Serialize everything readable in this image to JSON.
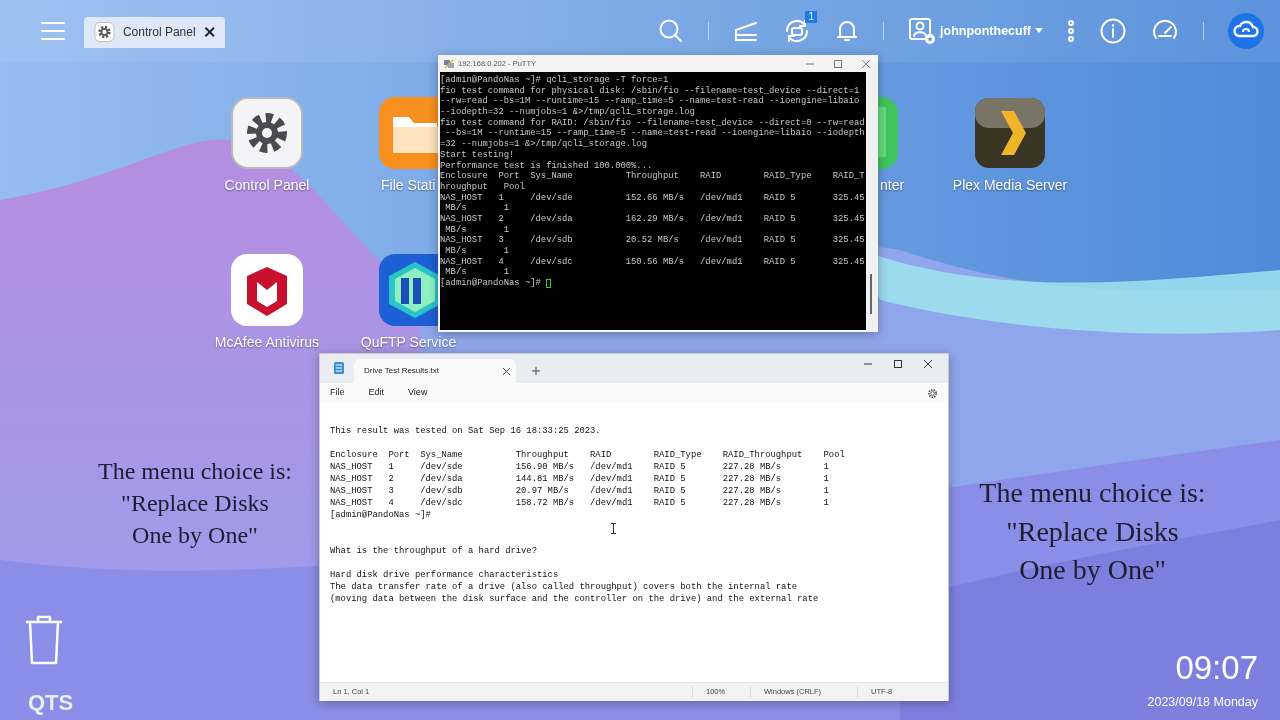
{
  "top_bar": {
    "tab": {
      "label": "Control Panel"
    },
    "notification_count": "1",
    "username": "johnponthecuff"
  },
  "desktop_icons": [
    {
      "label": "Control Panel",
      "kind": "gear"
    },
    {
      "label": "File Stati",
      "kind": "folder"
    },
    {
      "label": "nter",
      "kind": "green"
    },
    {
      "label": "Plex Media Server",
      "kind": "chevron"
    },
    {
      "label": "McAfee Antivirus",
      "kind": "shield"
    },
    {
      "label": "QuFTP Service",
      "kind": "ftp"
    }
  ],
  "captions": [
    {
      "lines": [
        "The menu choice is:",
        "\"Replace Disks",
        "One by One\""
      ]
    },
    {
      "lines": [
        "The menu choice is:",
        "\"Replace Disks",
        "One by One\""
      ]
    }
  ],
  "putty": {
    "title": "192.168.0.202 - PuTTY",
    "cursor": true,
    "lines": [
      "[admin@PandoNas ~]# qcli_storage -T force=1",
      "fio test command for physical disk: /sbin/fio --filename=test_device --direct=1",
      "--rw=read --bs=1M --runtime=15 --ramp_time=5 --name=test-read --ioengine=libaio",
      "--iodepth=32 --numjobs=1 &>/tmp/qcli_storage.log",
      "fio test command for RAID: /sbin/fio --filename=test_device --direct=0 --rw=read",
      " --bs=1M --runtime=15 --ramp_time=5 --name=test-read --ioengine=libaio --iodepth",
      "=32 --numjobs=1 &>/tmp/qcli_storage.log",
      "Start testing!",
      "Performance test is finished 100.000%...",
      "Enclosure  Port  Sys_Name          Throughput    RAID        RAID_Type    RAID_T",
      "hroughput   Pool",
      "NAS_HOST   1     /dev/sde          152.66 MB/s   /dev/md1    RAID 5       325.45",
      " MB/s       1",
      "NAS_HOST   2     /dev/sda          162.29 MB/s   /dev/md1    RAID 5       325.45",
      " MB/s       1",
      "NAS_HOST   3     /dev/sdb          20.52 MB/s    /dev/md1    RAID 5       325.45",
      " MB/s       1",
      "NAS_HOST   4     /dev/sdc          150.56 MB/s   /dev/md1    RAID 5       325.45",
      " MB/s       1",
      "[admin@PandoNas ~]#"
    ]
  },
  "notepad": {
    "tab": "Drive Test Results.txt",
    "menu": [
      "File",
      "Edit",
      "View"
    ],
    "sections": [
      [
        [
          "This result was tested on Sat Sep 16 18:33:25 2023."
        ],
        [
          "Enclosure  Port  Sys_Name          Throughput    RAID        RAID_Type    RAID_Throughput    Pool",
          "NAS_HOST   1     /dev/sde          156.90 MB/s   /dev/md1    RAID 5       227.28 MB/s        1",
          "NAS_HOST   2     /dev/sda          144.81 MB/s   /dev/md1    RAID 5       227.28 MB/s        1",
          "NAS_HOST   3     /dev/sdb          20.97 MB/s    /dev/md1    RAID 5       227.28 MB/s        1",
          "NAS_HOST   4     /dev/sdc          158.72 MB/s   /dev/md1    RAID 5       227.28 MB/s        1",
          "[admin@PandoNas ~]#"
        ]
      ],
      [
        [
          "What is the throughput of a hard drive?"
        ],
        [
          "Hard disk drive performance characteristics",
          "The data transfer rate of a drive (also called throughput) covers both the internal rate",
          "(moving data between the disk surface and the controller on the drive) and the external rate"
        ]
      ]
    ],
    "status": [
      "Ln 1, Col 1",
      "100%",
      "Windows (CRLF)",
      "UTF-8"
    ]
  },
  "clock": {
    "time": "09:07",
    "date": "2023/09/18 Monday"
  },
  "brand": "QTS"
}
